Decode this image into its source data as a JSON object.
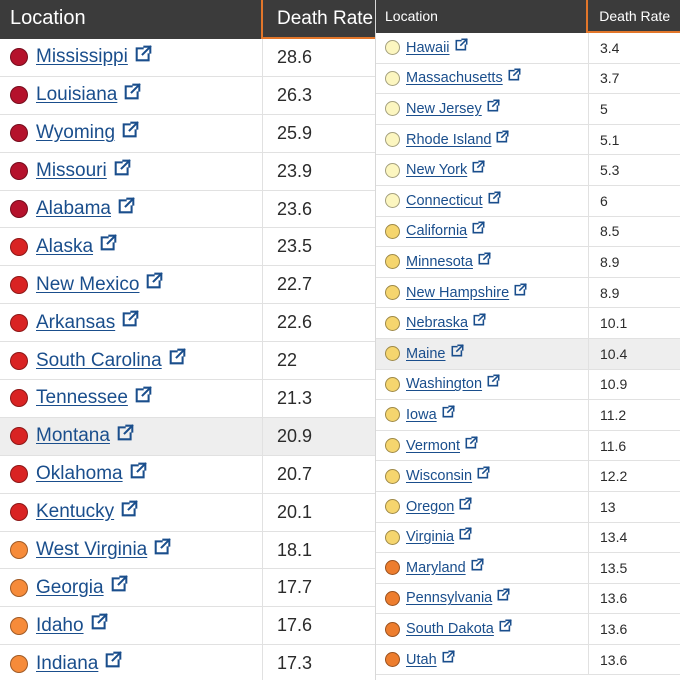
{
  "colors": {
    "header_bg": "#3b3b3b",
    "header_accent": "#e2762a",
    "link": "#1a4e8c",
    "darkred": "#b5122c",
    "red": "#d92323",
    "orange": "#f68b3a",
    "darkorange": "#ed7d2e",
    "yellow": "#f5d56e",
    "paleyellow": "#fcf6c0"
  },
  "left": {
    "header": {
      "location": "Location",
      "rate": "Death Rate"
    },
    "rows": [
      {
        "name": "Mississippi",
        "rate": "28.6",
        "color": "darkred"
      },
      {
        "name": "Louisiana",
        "rate": "26.3",
        "color": "darkred"
      },
      {
        "name": "Wyoming",
        "rate": "25.9",
        "color": "darkred"
      },
      {
        "name": "Missouri",
        "rate": "23.9",
        "color": "darkred"
      },
      {
        "name": "Alabama",
        "rate": "23.6",
        "color": "darkred"
      },
      {
        "name": "Alaska",
        "rate": "23.5",
        "color": "red"
      },
      {
        "name": "New Mexico",
        "rate": "22.7",
        "color": "red"
      },
      {
        "name": "Arkansas",
        "rate": "22.6",
        "color": "red"
      },
      {
        "name": "South Carolina",
        "rate": "22",
        "color": "red"
      },
      {
        "name": "Tennessee",
        "rate": "21.3",
        "color": "red"
      },
      {
        "name": "Montana",
        "rate": "20.9",
        "color": "red",
        "highlight": true
      },
      {
        "name": "Oklahoma",
        "rate": "20.7",
        "color": "red"
      },
      {
        "name": "Kentucky",
        "rate": "20.1",
        "color": "red"
      },
      {
        "name": "West Virginia",
        "rate": "18.1",
        "color": "orange"
      },
      {
        "name": "Georgia",
        "rate": "17.7",
        "color": "orange"
      },
      {
        "name": "Idaho",
        "rate": "17.6",
        "color": "orange"
      },
      {
        "name": "Indiana",
        "rate": "17.3",
        "color": "orange"
      }
    ]
  },
  "right": {
    "header": {
      "location": "Location",
      "rate": "Death Rate"
    },
    "rows": [
      {
        "name": "Hawaii",
        "rate": "3.4",
        "color": "paleyellow"
      },
      {
        "name": "Massachusetts",
        "rate": "3.7",
        "color": "paleyellow"
      },
      {
        "name": "New Jersey",
        "rate": "5",
        "color": "paleyellow"
      },
      {
        "name": "Rhode Island",
        "rate": "5.1",
        "color": "paleyellow"
      },
      {
        "name": "New York",
        "rate": "5.3",
        "color": "paleyellow"
      },
      {
        "name": "Connecticut",
        "rate": "6",
        "color": "paleyellow"
      },
      {
        "name": "California",
        "rate": "8.5",
        "color": "yellow"
      },
      {
        "name": "Minnesota",
        "rate": "8.9",
        "color": "yellow"
      },
      {
        "name": "New Hampshire",
        "rate": "8.9",
        "color": "yellow"
      },
      {
        "name": "Nebraska",
        "rate": "10.1",
        "color": "yellow"
      },
      {
        "name": "Maine",
        "rate": "10.4",
        "color": "yellow",
        "highlight": true
      },
      {
        "name": "Washington",
        "rate": "10.9",
        "color": "yellow"
      },
      {
        "name": "Iowa",
        "rate": "11.2",
        "color": "yellow"
      },
      {
        "name": "Vermont",
        "rate": "11.6",
        "color": "yellow"
      },
      {
        "name": "Wisconsin",
        "rate": "12.2",
        "color": "yellow"
      },
      {
        "name": "Oregon",
        "rate": "13",
        "color": "yellow"
      },
      {
        "name": "Virginia",
        "rate": "13.4",
        "color": "yellow"
      },
      {
        "name": "Maryland",
        "rate": "13.5",
        "color": "darkorange"
      },
      {
        "name": "Pennsylvania",
        "rate": "13.6",
        "color": "darkorange"
      },
      {
        "name": "South Dakota",
        "rate": "13.6",
        "color": "darkorange"
      },
      {
        "name": "Utah",
        "rate": "13.6",
        "color": "darkorange"
      }
    ]
  }
}
